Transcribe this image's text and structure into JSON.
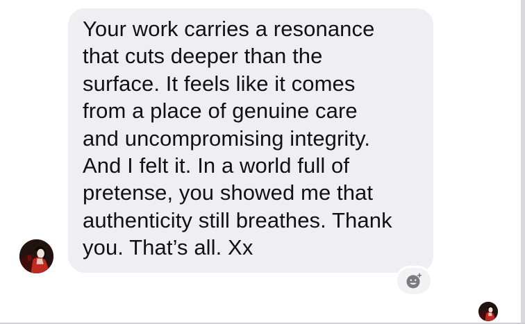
{
  "message": {
    "text": "Your work carries a resonance\nthat cuts deeper than the\nsurface. It feels like it comes\nfrom a place of genuine care\nand uncompromising integrity.\nAnd I felt it. In a world full of\npretense, you showed me that\nauthenticity still breathes. Thank\nyou. That’s all. Xx"
  },
  "sender": {
    "avatar_icon": "profile-photo"
  },
  "reaction": {
    "icon": "add-reaction-icon"
  },
  "seen_indicator": {
    "avatar_icon": "profile-photo"
  },
  "colors": {
    "bubble_background": "#efeff3",
    "message_text": "#111111",
    "reaction_icon": "#7a7a80",
    "avatar_accent": "#c12a22"
  }
}
